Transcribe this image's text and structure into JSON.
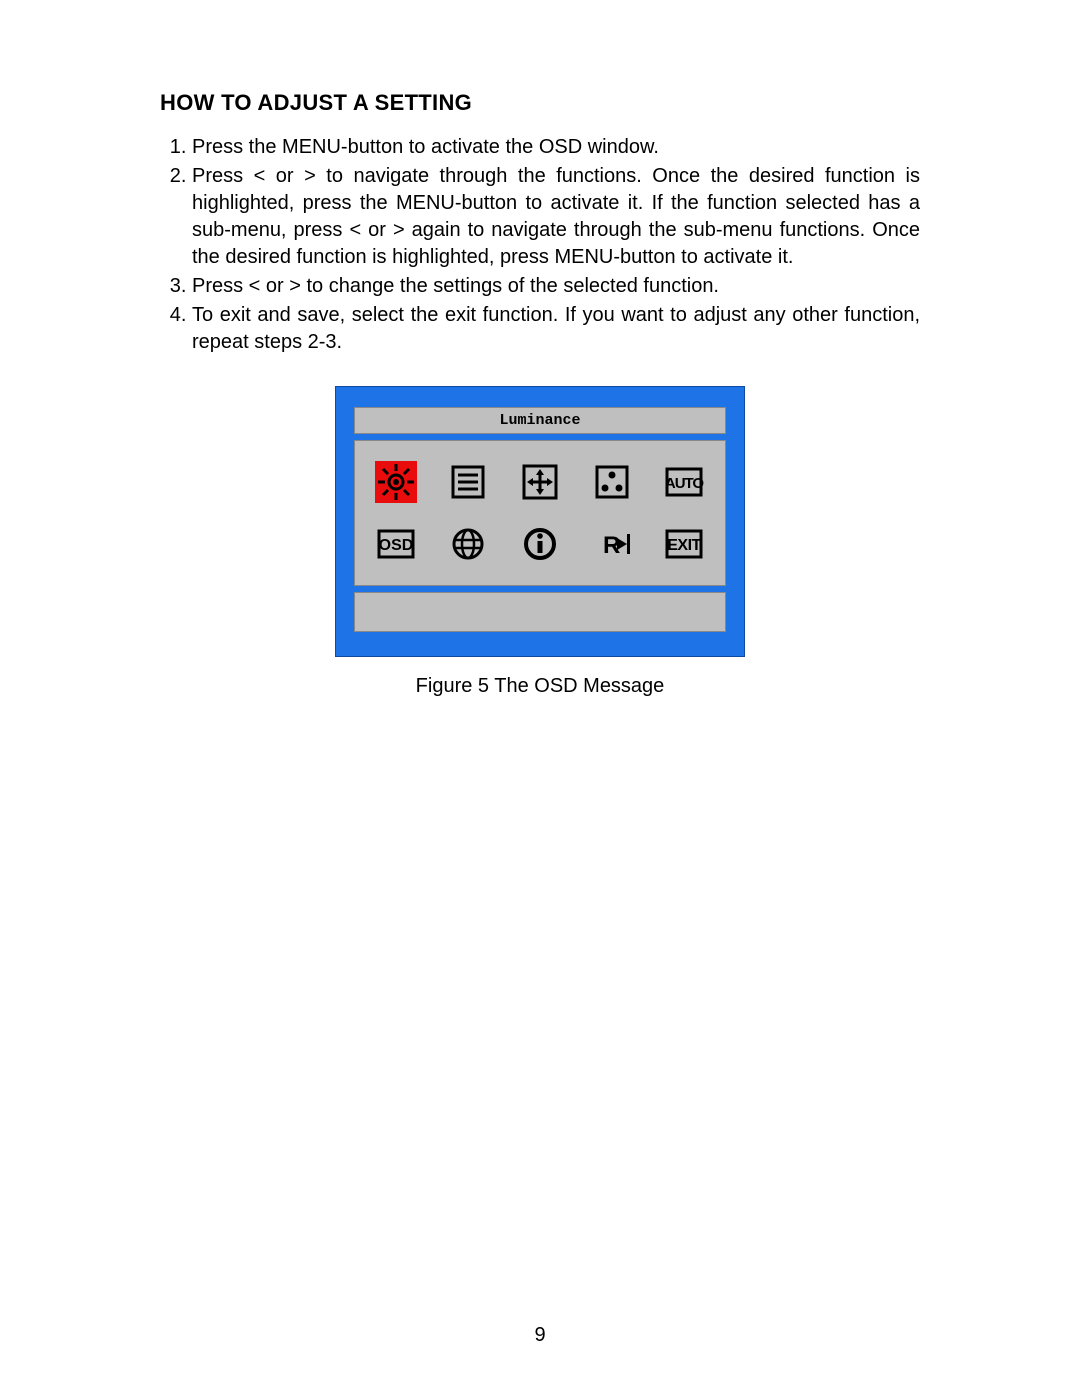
{
  "heading": "HOW TO ADJUST A SETTING",
  "steps": [
    "Press the MENU-button to activate the OSD window.",
    "Press < or > to navigate through the functions. Once the desired function is highlighted, press the MENU-button  to activate it.  If the function selected has a sub-menu, press < or > again to navigate through the sub-menu functions.   Once the desired function is highlighted, press MENU-button to activate it.",
    "Press  < or  > to change the settings of the selected function.",
    "To exit and save, select the exit function. If you want to adjust any other function, repeat steps 2-3."
  ],
  "osd": {
    "title": "Luminance",
    "row1": [
      {
        "name": "luminance-icon",
        "selected": true
      },
      {
        "name": "image-setup-icon"
      },
      {
        "name": "position-icon"
      },
      {
        "name": "color-temp-icon"
      },
      {
        "name": "auto-icon",
        "text": "AUTO"
      }
    ],
    "row2": [
      {
        "name": "osd-setup-icon",
        "text": "OSD"
      },
      {
        "name": "language-icon"
      },
      {
        "name": "information-icon"
      },
      {
        "name": "reset-icon"
      },
      {
        "name": "exit-icon",
        "text": "EXIT"
      }
    ]
  },
  "figure_caption": "Figure 5     The  OSD  Message",
  "page_number": "9"
}
